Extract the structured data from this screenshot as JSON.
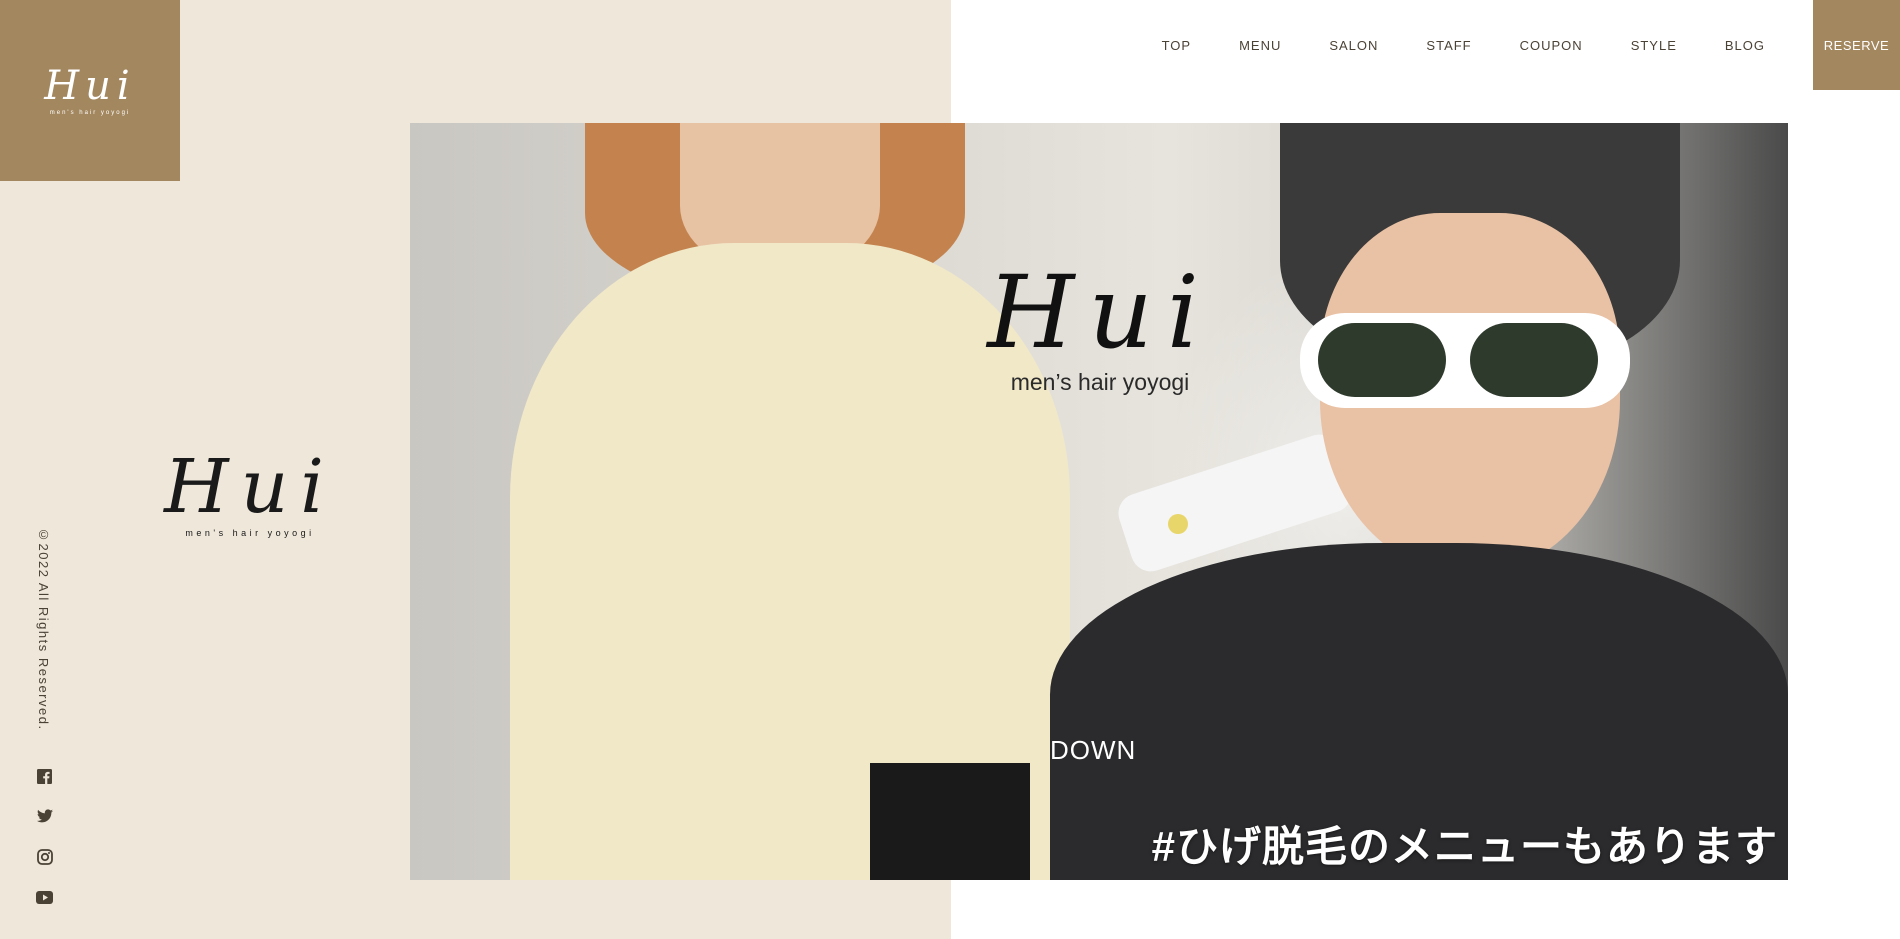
{
  "header": {
    "logo_script": "Hui",
    "logo_sub": "men's hair yoyogi",
    "nav": [
      "TOP",
      "MENU",
      "SALON",
      "STAFF",
      "COUPON",
      "STYLE",
      "BLOG"
    ],
    "reserve_label": "RESERVE"
  },
  "sidebar": {
    "logo_script": "Hui",
    "logo_sub": "men's hair yoyogi",
    "copyright": "©2022 All Rights Reserved.",
    "social": [
      "facebook-icon",
      "twitter-icon",
      "instagram-icon",
      "youtube-icon"
    ]
  },
  "hero": {
    "logo_script": "Hui",
    "logo_sub": "men’s hair yoyogi",
    "down_label": "DOWN",
    "caption": "#ひげ脱毛のメニューもあります"
  },
  "colors": {
    "accent": "#a3875f",
    "panel": "#eee7da",
    "text": "#4b4236"
  }
}
